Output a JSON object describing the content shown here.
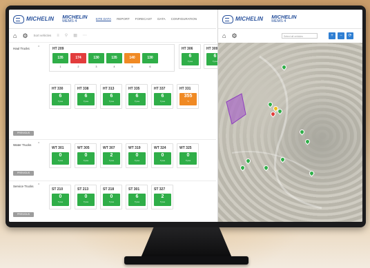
{
  "header": {
    "brand_logo": "MICHELIN",
    "app_name": "MICHELIN",
    "app_version": "MEMS 4",
    "nav": [
      "SITE DATA",
      "REPORT",
      "FORECAST",
      "DATA",
      "CONFIGURATION"
    ]
  },
  "toolbar": {
    "sort_label": "Sort vehicles",
    "home_icon": "home-icon",
    "settings_icon": "gear-icon"
  },
  "groups": [
    {
      "label": "Haul Trucks",
      "button": "PREVIOUS",
      "big_vehicle": "HT 209",
      "segments": [
        {
          "value": "135",
          "color": "#2fae48",
          "n": "1"
        },
        {
          "value": "174",
          "color": "#e23c3c",
          "n": "2"
        },
        {
          "value": "130",
          "color": "#2fae48",
          "n": "3"
        },
        {
          "value": "135",
          "color": "#2fae48",
          "n": "4"
        },
        {
          "value": "140",
          "color": "#f08a24",
          "n": "5"
        },
        {
          "value": "130",
          "color": "#2fae48",
          "n": "6"
        }
      ],
      "cards": [
        {
          "id": "HT 330",
          "value": "6",
          "color": "#2fae48",
          "sub": "Tyres"
        },
        {
          "id": "HT 338",
          "value": "6",
          "color": "#2fae48",
          "sub": "Tyres"
        },
        {
          "id": "HT 313",
          "value": "6",
          "color": "#2fae48",
          "sub": "Tyres"
        },
        {
          "id": "HT 335",
          "value": "6",
          "color": "#2fae48",
          "sub": "Tyres"
        },
        {
          "id": "HT 337",
          "value": "6",
          "color": "#2fae48",
          "sub": "Tyres"
        },
        {
          "id": "HT 331",
          "value": "355",
          "color": "#f08a24",
          "sub": "°C"
        }
      ],
      "top_right_cards": [
        {
          "id": "HT 306",
          "value": "6",
          "color": "#2fae48",
          "sub": "Tyres"
        },
        {
          "id": "HT 309",
          "value": "6",
          "color": "#2fae48",
          "sub": "Tyres"
        }
      ]
    },
    {
      "label": "Water Trucks",
      "button": "PREVIOUS",
      "cards": [
        {
          "id": "WT 301",
          "value": "0",
          "color": "#2fae48",
          "sub": "Tyres"
        },
        {
          "id": "WT 305",
          "value": "0",
          "color": "#2fae48",
          "sub": "Tyres"
        },
        {
          "id": "WT 307",
          "value": "2",
          "color": "#2fae48",
          "sub": "Tyres"
        },
        {
          "id": "WT 319",
          "value": "0",
          "color": "#2fae48",
          "sub": "Tyres"
        },
        {
          "id": "WT 324",
          "value": "0",
          "color": "#2fae48",
          "sub": "Tyres"
        },
        {
          "id": "WT 325",
          "value": "0",
          "color": "#2fae48",
          "sub": "Tyres"
        }
      ]
    },
    {
      "label": "Service Trucks",
      "button": "PREVIOUS",
      "cards": [
        {
          "id": "ST 210",
          "value": "0",
          "color": "#2fae48",
          "sub": "Tyres"
        },
        {
          "id": "ST 213",
          "value": "0",
          "color": "#2fae48",
          "sub": "Tyres"
        },
        {
          "id": "ST 218",
          "value": "0",
          "color": "#2fae48",
          "sub": "Tyres"
        },
        {
          "id": "ST 301",
          "value": "6",
          "color": "#2fae48",
          "sub": "Tyres"
        },
        {
          "id": "ST 327",
          "value": "2",
          "color": "#2fae48",
          "sub": "Tyres"
        }
      ]
    }
  ],
  "map_panel": {
    "brand_logo": "MICHELIN",
    "app_name": "MICHELIN",
    "app_version": "MEMS 4",
    "select_placeholder": "Select all vehicles",
    "buttons": [
      "+",
      "−",
      "⟳"
    ]
  },
  "colors": {
    "ok": "#2fae48",
    "alert": "#e23c3c",
    "warning": "#f08a24",
    "brand": "#27509b"
  }
}
